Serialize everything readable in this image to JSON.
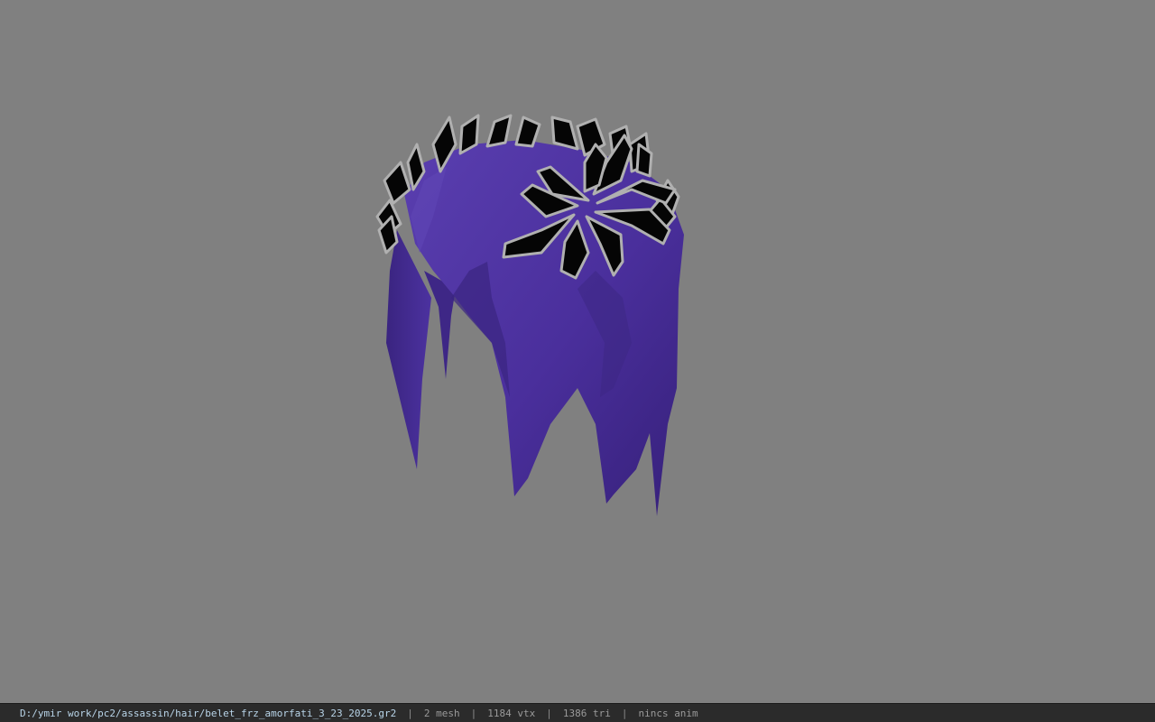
{
  "viewport": {
    "background_color": "#808080",
    "model": {
      "hair_color": "#4f34a0",
      "hair_shadow_color": "#3b2580",
      "leaf_color": "#050505",
      "leaf_edge_color": "#b0b0b0"
    }
  },
  "status_bar": {
    "file_path": "D:/ymir work/pc2/assassin/hair/belet_frz_amorfati_3_23_2025.gr2",
    "separator": "|",
    "mesh_count": "2 mesh",
    "vertex_count": "1184 vtx",
    "triangle_count": "1386 tri",
    "animation": "nincs anim"
  }
}
